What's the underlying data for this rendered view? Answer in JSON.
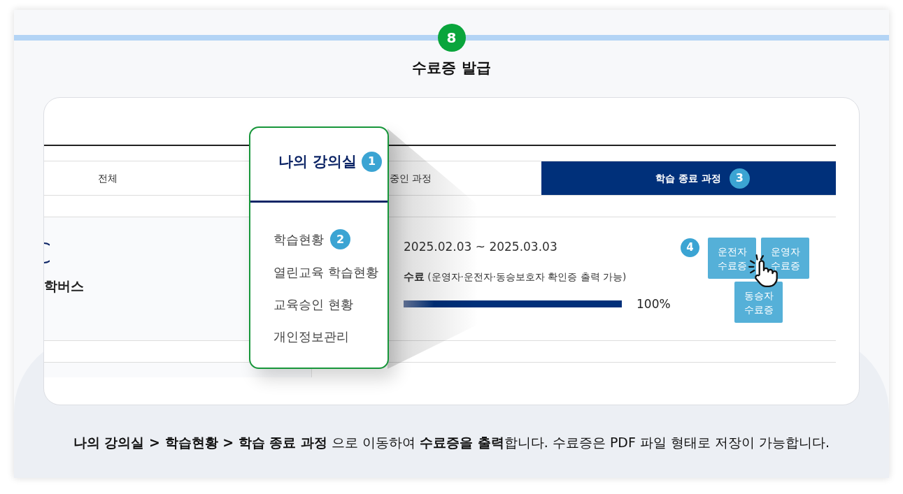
{
  "step": {
    "number": "8",
    "title": "수료증 발급"
  },
  "screen": {
    "tabs": [
      {
        "label": "전체",
        "selected": false
      },
      {
        "label": "중인 과정",
        "selected": false
      },
      {
        "label": "학습 종료 과정",
        "selected": true,
        "marker": "3"
      }
    ],
    "course": {
      "title": "학버스",
      "period": "2025.02.03 ~ 2025.03.03",
      "status": "**수료** (운영자·운전자·동승보호자 확인증 출력 가능)",
      "progress": {
        "level": 1,
        "reading": "100%"
      },
      "marker": "4",
      "certificates": [
        "운전자 수료증",
        "운영자 수료증",
        "동승자 수료증"
      ]
    }
  },
  "menu": {
    "title": "나의 강의실",
    "marker": "1",
    "items": [
      {
        "label": "학습현황",
        "marker": "2"
      },
      {
        "label": "열린교육 학습현황"
      },
      {
        "label": "교육승인 현황"
      },
      {
        "label": "개인정보관리"
      }
    ]
  },
  "caption": "**나의 강의실 > 학습현황 > 학습 종료 과정** 으로 이동하여 **수료증을 출력**합니다. 수료증은 PDF 파일 형태로 저장이 가능합니다."
}
